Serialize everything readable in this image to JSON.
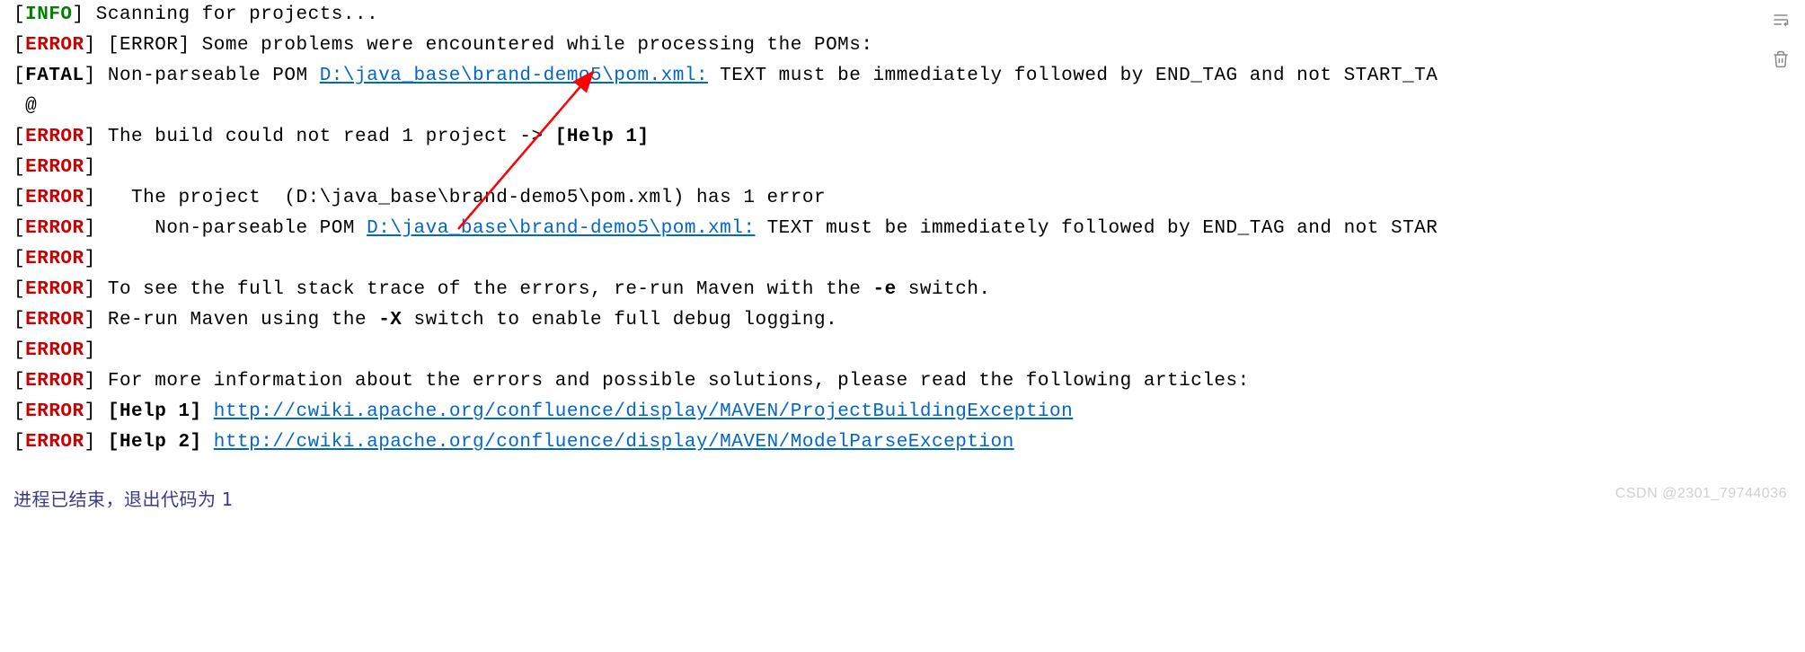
{
  "lines": [
    {
      "tag": "INFO",
      "text": "Scanning for projects..."
    },
    {
      "tag": "ERROR",
      "segments": [
        {
          "t": "text",
          "v": "[ERROR] Some problems were encountered while processing the POMs:"
        }
      ]
    },
    {
      "tag": "FATAL",
      "segments": [
        {
          "t": "text",
          "v": "Non-parseable POM "
        },
        {
          "t": "link",
          "v": "D:\\java_base\\brand-demo5\\pom.xml:"
        },
        {
          "t": "text",
          "v": " TEXT must be immediately followed by END_TAG and not START_TA"
        }
      ]
    },
    {
      "raw": " @ "
    },
    {
      "tag": "ERROR",
      "segments": [
        {
          "t": "text",
          "v": "The build could not read 1 project -> "
        },
        {
          "t": "bold",
          "v": "[Help 1]"
        }
      ]
    },
    {
      "tag": "ERROR",
      "segments": []
    },
    {
      "tag": "ERROR",
      "segments": [
        {
          "t": "text",
          "v": "  The project  (D:\\java_base\\brand-demo5\\pom.xml) has 1 error"
        }
      ]
    },
    {
      "tag": "ERROR",
      "segments": [
        {
          "t": "text",
          "v": "    Non-parseable POM "
        },
        {
          "t": "link",
          "v": "D:\\java_base\\brand-demo5\\pom.xml:"
        },
        {
          "t": "text",
          "v": " TEXT must be immediately followed by END_TAG and not STAR"
        }
      ]
    },
    {
      "tag": "ERROR",
      "segments": []
    },
    {
      "tag": "ERROR",
      "segments": [
        {
          "t": "text",
          "v": "To see the full stack trace of the errors, re-run Maven with the "
        },
        {
          "t": "bold",
          "v": "-e"
        },
        {
          "t": "text",
          "v": " switch."
        }
      ]
    },
    {
      "tag": "ERROR",
      "segments": [
        {
          "t": "text",
          "v": "Re-run Maven using the "
        },
        {
          "t": "bold",
          "v": "-X"
        },
        {
          "t": "text",
          "v": " switch to enable full debug logging."
        }
      ]
    },
    {
      "tag": "ERROR",
      "segments": []
    },
    {
      "tag": "ERROR",
      "segments": [
        {
          "t": "text",
          "v": "For more information about the errors and possible solutions, please read the following articles:"
        }
      ]
    },
    {
      "tag": "ERROR",
      "segments": [
        {
          "t": "bold",
          "v": "[Help 1]"
        },
        {
          "t": "text",
          "v": " "
        },
        {
          "t": "link",
          "v": "http://cwiki.apache.org/confluence/display/MAVEN/ProjectBuildingException"
        }
      ]
    },
    {
      "tag": "ERROR",
      "segments": [
        {
          "t": "bold",
          "v": "[Help 2]"
        },
        {
          "t": "text",
          "v": " "
        },
        {
          "t": "link",
          "v": "http://cwiki.apache.org/confluence/display/MAVEN/ModelParseException"
        }
      ]
    }
  ],
  "exit": {
    "prefix": "进程已结束，退出代码为 ",
    "code": "1"
  },
  "watermark": "CSDN @2301_79744036",
  "tags": {
    "INFO": {
      "class": "tag-info",
      "label": "[INFO]"
    },
    "ERROR": {
      "class": "tag-error",
      "label": "[ERROR]"
    },
    "FATAL": {
      "class": "tag-fatal",
      "label": "[FATAL]"
    }
  }
}
